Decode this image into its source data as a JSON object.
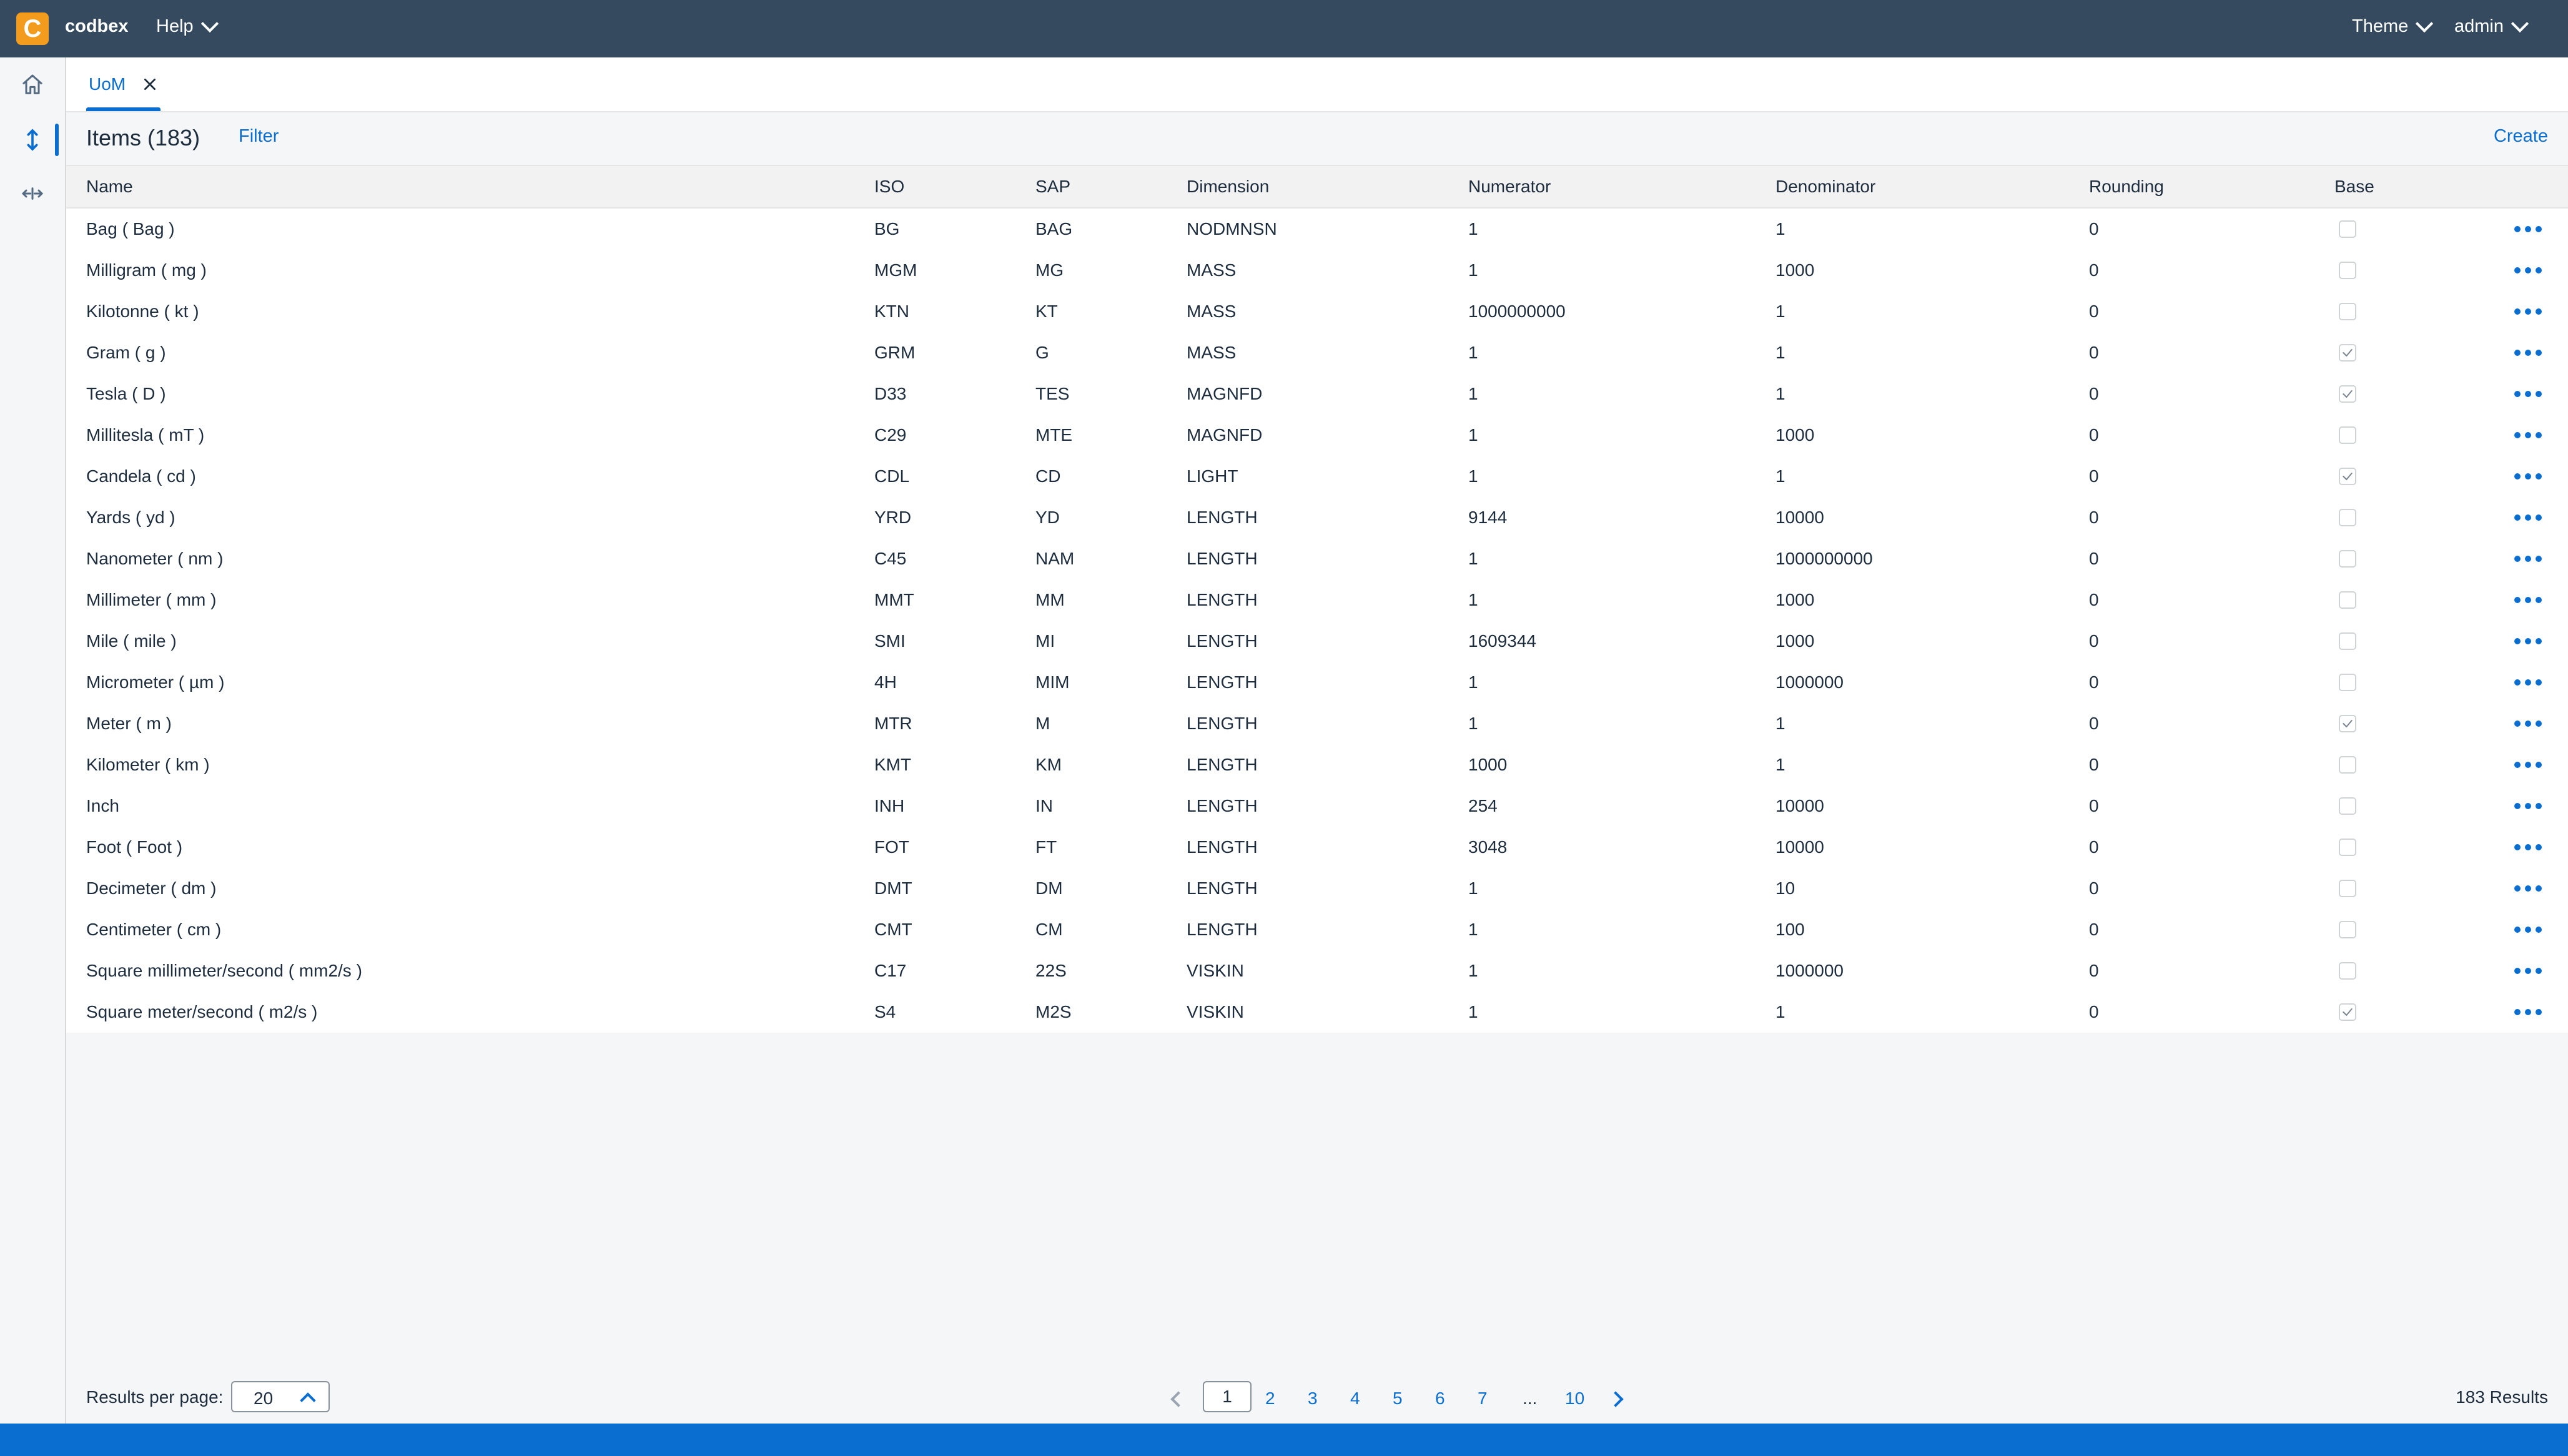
{
  "shell": {
    "brand": "codbex",
    "logo_letter": "C",
    "help_label": "Help",
    "theme_label": "Theme",
    "user_label": "admin",
    "accent_color": "#0a6ed1",
    "shell_color": "#354a5f"
  },
  "sidenav": {
    "items": [
      {
        "icon": "home-icon"
      },
      {
        "icon": "vertical-arrows-icon",
        "active": true
      },
      {
        "icon": "horizontal-arrows-icon"
      }
    ]
  },
  "tabs": [
    {
      "label": "UoM",
      "closable": true
    }
  ],
  "toolbar": {
    "title": "Items (183)",
    "filter_label": "Filter",
    "create_label": "Create"
  },
  "table": {
    "columns": [
      "Name",
      "ISO",
      "SAP",
      "Dimension",
      "Numerator",
      "Denominator",
      "Rounding",
      "Base"
    ],
    "rows": [
      {
        "name": "Bag ( Bag )",
        "iso": "BG",
        "sap": "BAG",
        "dim": "NODMNSN",
        "num": "1",
        "den": "1",
        "rnd": "0",
        "base": false
      },
      {
        "name": "Milligram ( mg )",
        "iso": "MGM",
        "sap": "MG",
        "dim": "MASS",
        "num": "1",
        "den": "1000",
        "rnd": "0",
        "base": false
      },
      {
        "name": "Kilotonne ( kt )",
        "iso": "KTN",
        "sap": "KT",
        "dim": "MASS",
        "num": "1000000000",
        "den": "1",
        "rnd": "0",
        "base": false
      },
      {
        "name": "Gram ( g )",
        "iso": "GRM",
        "sap": "G",
        "dim": "MASS",
        "num": "1",
        "den": "1",
        "rnd": "0",
        "base": true
      },
      {
        "name": "Tesla ( D )",
        "iso": "D33",
        "sap": "TES",
        "dim": "MAGNFD",
        "num": "1",
        "den": "1",
        "rnd": "0",
        "base": true
      },
      {
        "name": "Millitesla ( mT )",
        "iso": "C29",
        "sap": "MTE",
        "dim": "MAGNFD",
        "num": "1",
        "den": "1000",
        "rnd": "0",
        "base": false
      },
      {
        "name": "Candela ( cd )",
        "iso": "CDL",
        "sap": "CD",
        "dim": "LIGHT",
        "num": "1",
        "den": "1",
        "rnd": "0",
        "base": true
      },
      {
        "name": "Yards ( yd )",
        "iso": "YRD",
        "sap": "YD",
        "dim": "LENGTH",
        "num": "9144",
        "den": "10000",
        "rnd": "0",
        "base": false
      },
      {
        "name": "Nanometer ( nm )",
        "iso": "C45",
        "sap": "NAM",
        "dim": "LENGTH",
        "num": "1",
        "den": "1000000000",
        "rnd": "0",
        "base": false
      },
      {
        "name": "Millimeter ( mm )",
        "iso": "MMT",
        "sap": "MM",
        "dim": "LENGTH",
        "num": "1",
        "den": "1000",
        "rnd": "0",
        "base": false
      },
      {
        "name": "Mile ( mile )",
        "iso": "SMI",
        "sap": "MI",
        "dim": "LENGTH",
        "num": "1609344",
        "den": "1000",
        "rnd": "0",
        "base": false
      },
      {
        "name": "Micrometer ( µm )",
        "iso": "4H",
        "sap": "MIM",
        "dim": "LENGTH",
        "num": "1",
        "den": "1000000",
        "rnd": "0",
        "base": false
      },
      {
        "name": "Meter ( m )",
        "iso": "MTR",
        "sap": "M",
        "dim": "LENGTH",
        "num": "1",
        "den": "1",
        "rnd": "0",
        "base": true
      },
      {
        "name": "Kilometer ( km )",
        "iso": "KMT",
        "sap": "KM",
        "dim": "LENGTH",
        "num": "1000",
        "den": "1",
        "rnd": "0",
        "base": false
      },
      {
        "name": "Inch",
        "iso": "INH",
        "sap": "IN",
        "dim": "LENGTH",
        "num": "254",
        "den": "10000",
        "rnd": "0",
        "base": false
      },
      {
        "name": "Foot ( Foot )",
        "iso": "FOT",
        "sap": "FT",
        "dim": "LENGTH",
        "num": "3048",
        "den": "10000",
        "rnd": "0",
        "base": false
      },
      {
        "name": "Decimeter ( dm )",
        "iso": "DMT",
        "sap": "DM",
        "dim": "LENGTH",
        "num": "1",
        "den": "10",
        "rnd": "0",
        "base": false
      },
      {
        "name": "Centimeter ( cm )",
        "iso": "CMT",
        "sap": "CM",
        "dim": "LENGTH",
        "num": "1",
        "den": "100",
        "rnd": "0",
        "base": false
      },
      {
        "name": "Square millimeter/second ( mm2/s )",
        "iso": "C17",
        "sap": "22S",
        "dim": "VISKIN",
        "num": "1",
        "den": "1000000",
        "rnd": "0",
        "base": false
      },
      {
        "name": "Square meter/second ( m2/s )",
        "iso": "S4",
        "sap": "M2S",
        "dim": "VISKIN",
        "num": "1",
        "den": "1",
        "rnd": "0",
        "base": true
      }
    ]
  },
  "footer": {
    "rpp_label": "Results per page:",
    "rpp_value": "20",
    "pages": [
      "1",
      "2",
      "3",
      "4",
      "5",
      "6",
      "7",
      "...",
      "10"
    ],
    "current_page": "1",
    "results_label": "183 Results"
  }
}
